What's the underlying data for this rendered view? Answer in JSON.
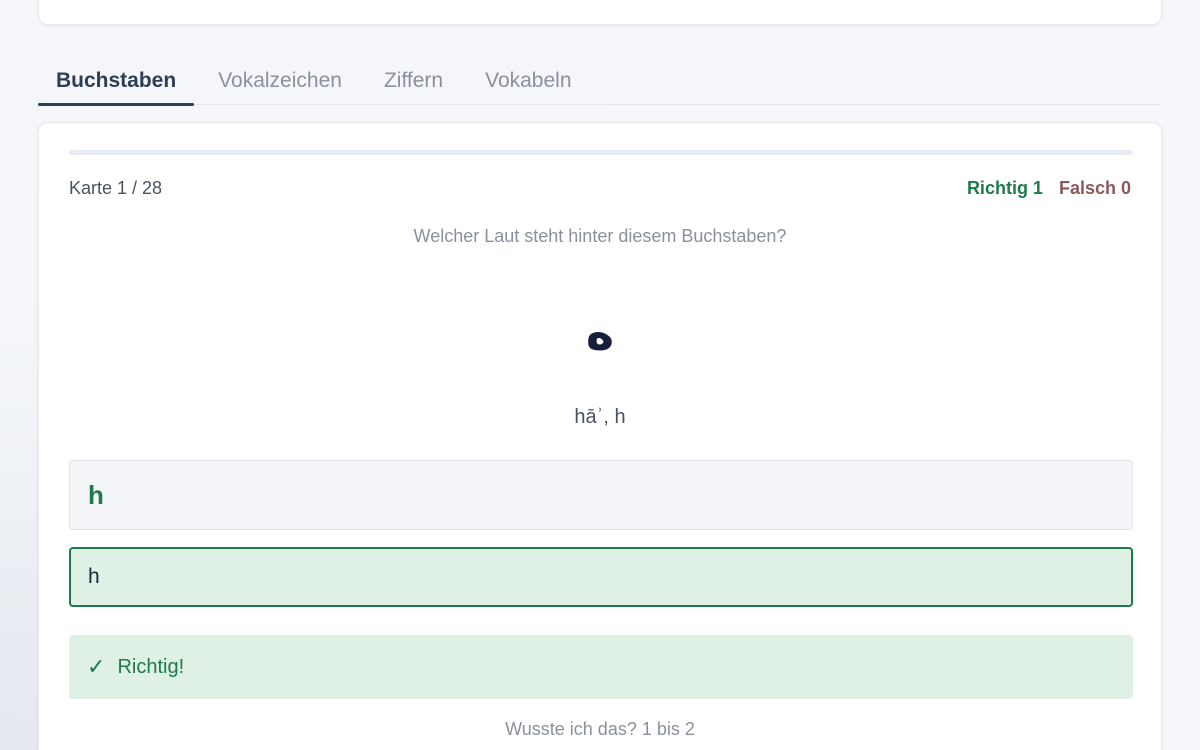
{
  "tabs": [
    {
      "label": "Buchstaben",
      "active": true
    },
    {
      "label": "Vokalzeichen",
      "active": false
    },
    {
      "label": "Ziffern",
      "active": false
    },
    {
      "label": "Vokabeln",
      "active": false
    }
  ],
  "card": {
    "progress_fraction": 0.0,
    "counter": "Karte 1 / 28",
    "score": {
      "right_label": "Richtig 1",
      "wrong_label": "Falsch 0"
    },
    "question": "Welcher Laut steht hinter diesem Buchstaben?",
    "letter": "ه",
    "transliteration": "hāʾ, h",
    "expected_answer": "h",
    "user_input": "h",
    "feedback": {
      "icon": "check-icon",
      "text": "Richtig!"
    },
    "self_rating": "Wusste ich das?  1 bis 2"
  },
  "colors": {
    "accent": "#2f3e55",
    "correct": "#1f7a4c",
    "wrong": "#8a5a5a",
    "correct_bg": "#dff0e5"
  }
}
